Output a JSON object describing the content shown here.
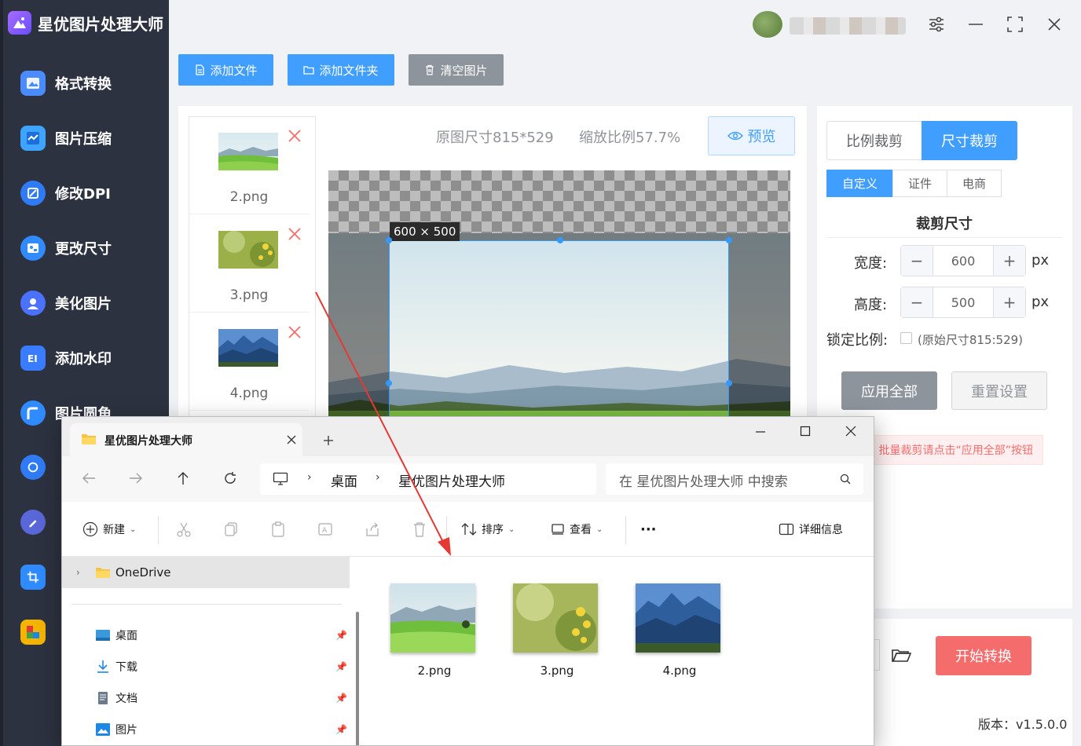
{
  "app": {
    "title": "星优图片处理大师",
    "sidebar": [
      {
        "label": "格式转换",
        "icon": "format-convert-icon",
        "color": "#4a8cff"
      },
      {
        "label": "图片压缩",
        "icon": "compress-icon",
        "color": "#3fa4ff"
      },
      {
        "label": "修改DPI",
        "icon": "dpi-icon",
        "color": "#2f7bf6"
      },
      {
        "label": "更改尺寸",
        "icon": "resize-icon",
        "color": "#2f8bff"
      },
      {
        "label": "美化图片",
        "icon": "beautify-icon",
        "color": "#4a72ff"
      },
      {
        "label": "添加水印",
        "icon": "watermark-icon",
        "color": "#3a7cff"
      },
      {
        "label": "图片圆角",
        "icon": "round-corner-icon",
        "color": "#2f8bff"
      }
    ]
  },
  "toolbar": {
    "add_file": "添加文件",
    "add_folder": "添加文件夹",
    "clear": "清空图片"
  },
  "files": [
    {
      "name": "2.png"
    },
    {
      "name": "3.png"
    },
    {
      "name": "4.png"
    }
  ],
  "preview": {
    "original_size": "原图尺寸815*529",
    "zoom": "缩放比例57.7%",
    "button": "预览",
    "crop_label": "600 × 500"
  },
  "crop_panel": {
    "mode_ratio": "比例裁剪",
    "mode_size": "尺寸裁剪",
    "sub_custom": "自定义",
    "sub_id": "证件",
    "sub_ecommerce": "电商",
    "section_title": "裁剪尺寸",
    "width_label": "宽度:",
    "width_value": "600",
    "height_label": "高度:",
    "height_value": "500",
    "unit": "px",
    "lock_label": "锁定比例:",
    "lock_hint": "(原始尺寸815:529)",
    "apply_all": "应用全部",
    "reset": "重置设置",
    "hint": "批量裁剪请点击“应用全部”按钮"
  },
  "bottom": {
    "start": "开始转换",
    "version": "版本：v1.5.0.0"
  },
  "explorer": {
    "tab_title": "星优图片处理大师",
    "breadcrumb": [
      "桌面",
      "星优图片处理大师"
    ],
    "search_placeholder": "在 星优图片处理大师 中搜索",
    "cmd_new": "新建",
    "cmd_sort": "排序",
    "cmd_view": "查看",
    "cmd_more": "···",
    "cmd_details": "详细信息",
    "nav": {
      "onedrive": "OneDrive",
      "items": [
        {
          "label": "桌面"
        },
        {
          "label": "下载"
        },
        {
          "label": "文档"
        },
        {
          "label": "图片"
        }
      ]
    },
    "files": [
      {
        "name": "2.png"
      },
      {
        "name": "3.png"
      },
      {
        "name": "4.png"
      }
    ]
  },
  "colors": {
    "primary": "#409eff",
    "danger": "#f56c6c",
    "sidebar": "#2d3240",
    "annotation_arrow": "#e53935"
  }
}
